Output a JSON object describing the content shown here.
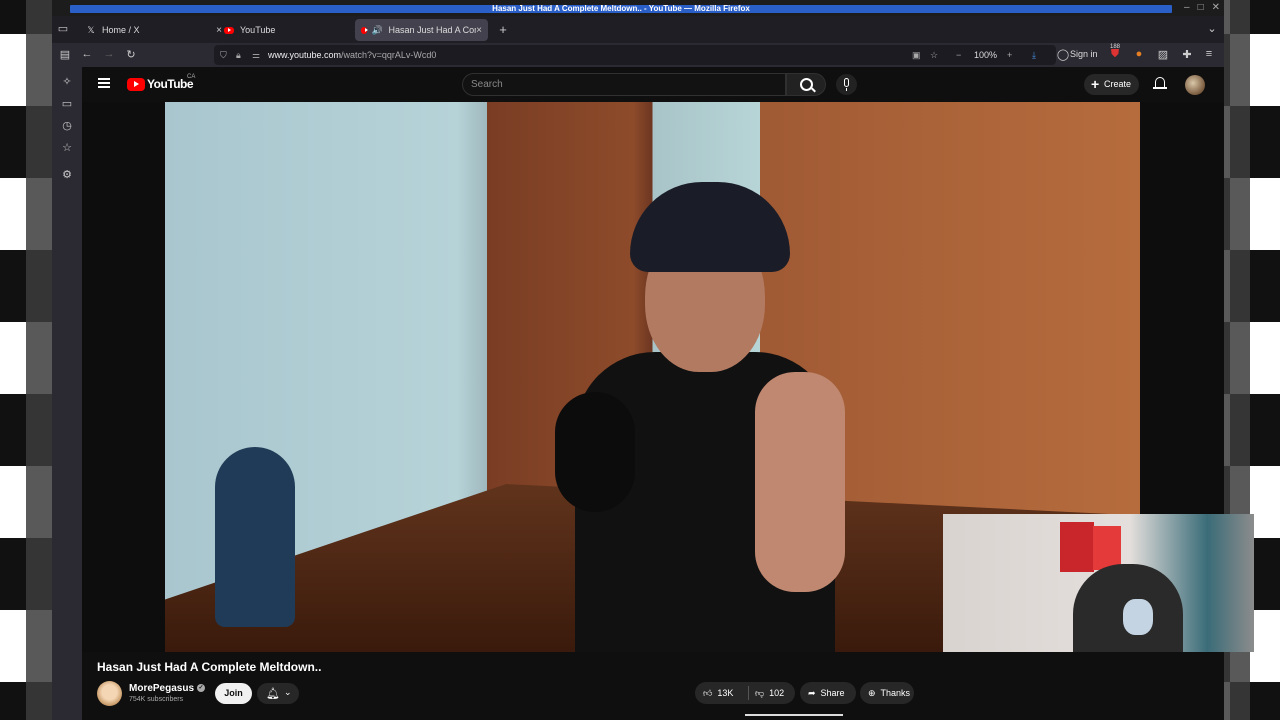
{
  "window": {
    "title": "Hasan Just Had A Complete Meltdown.. - YouTube — Mozilla Firefox"
  },
  "tabs": [
    {
      "label": "Home / X",
      "icon": "x-logo-icon",
      "active": false
    },
    {
      "label": "YouTube",
      "icon": "youtube-favicon-icon",
      "active": false
    },
    {
      "label": "Hasan Just Had A Complete Meltdown..",
      "icon": "youtube-favicon-icon",
      "active": true
    }
  ],
  "navbar": {
    "url_host": "www.youtube.com",
    "url_path": "/watch?v=qqrALv-Wcd0",
    "zoom": "100%",
    "signin_label": "Sign in",
    "badge_count": "188"
  },
  "youtube": {
    "logo_text": "YouTube",
    "country_code": "CA",
    "search_placeholder": "Search",
    "create_label": "Create"
  },
  "video": {
    "title": "Hasan Just Had A Complete Meltdown..",
    "channel": "MorePegasus",
    "subscribers": "754K subscribers",
    "join_label": "Join",
    "likes": "13K",
    "dislikes": "102",
    "share_label": "Share",
    "thanks_label": "Thanks"
  },
  "colors": {
    "youtube_red": "#ff0000",
    "titlebar_accent": "#2a5fc7",
    "background": "#0f0f0f"
  }
}
